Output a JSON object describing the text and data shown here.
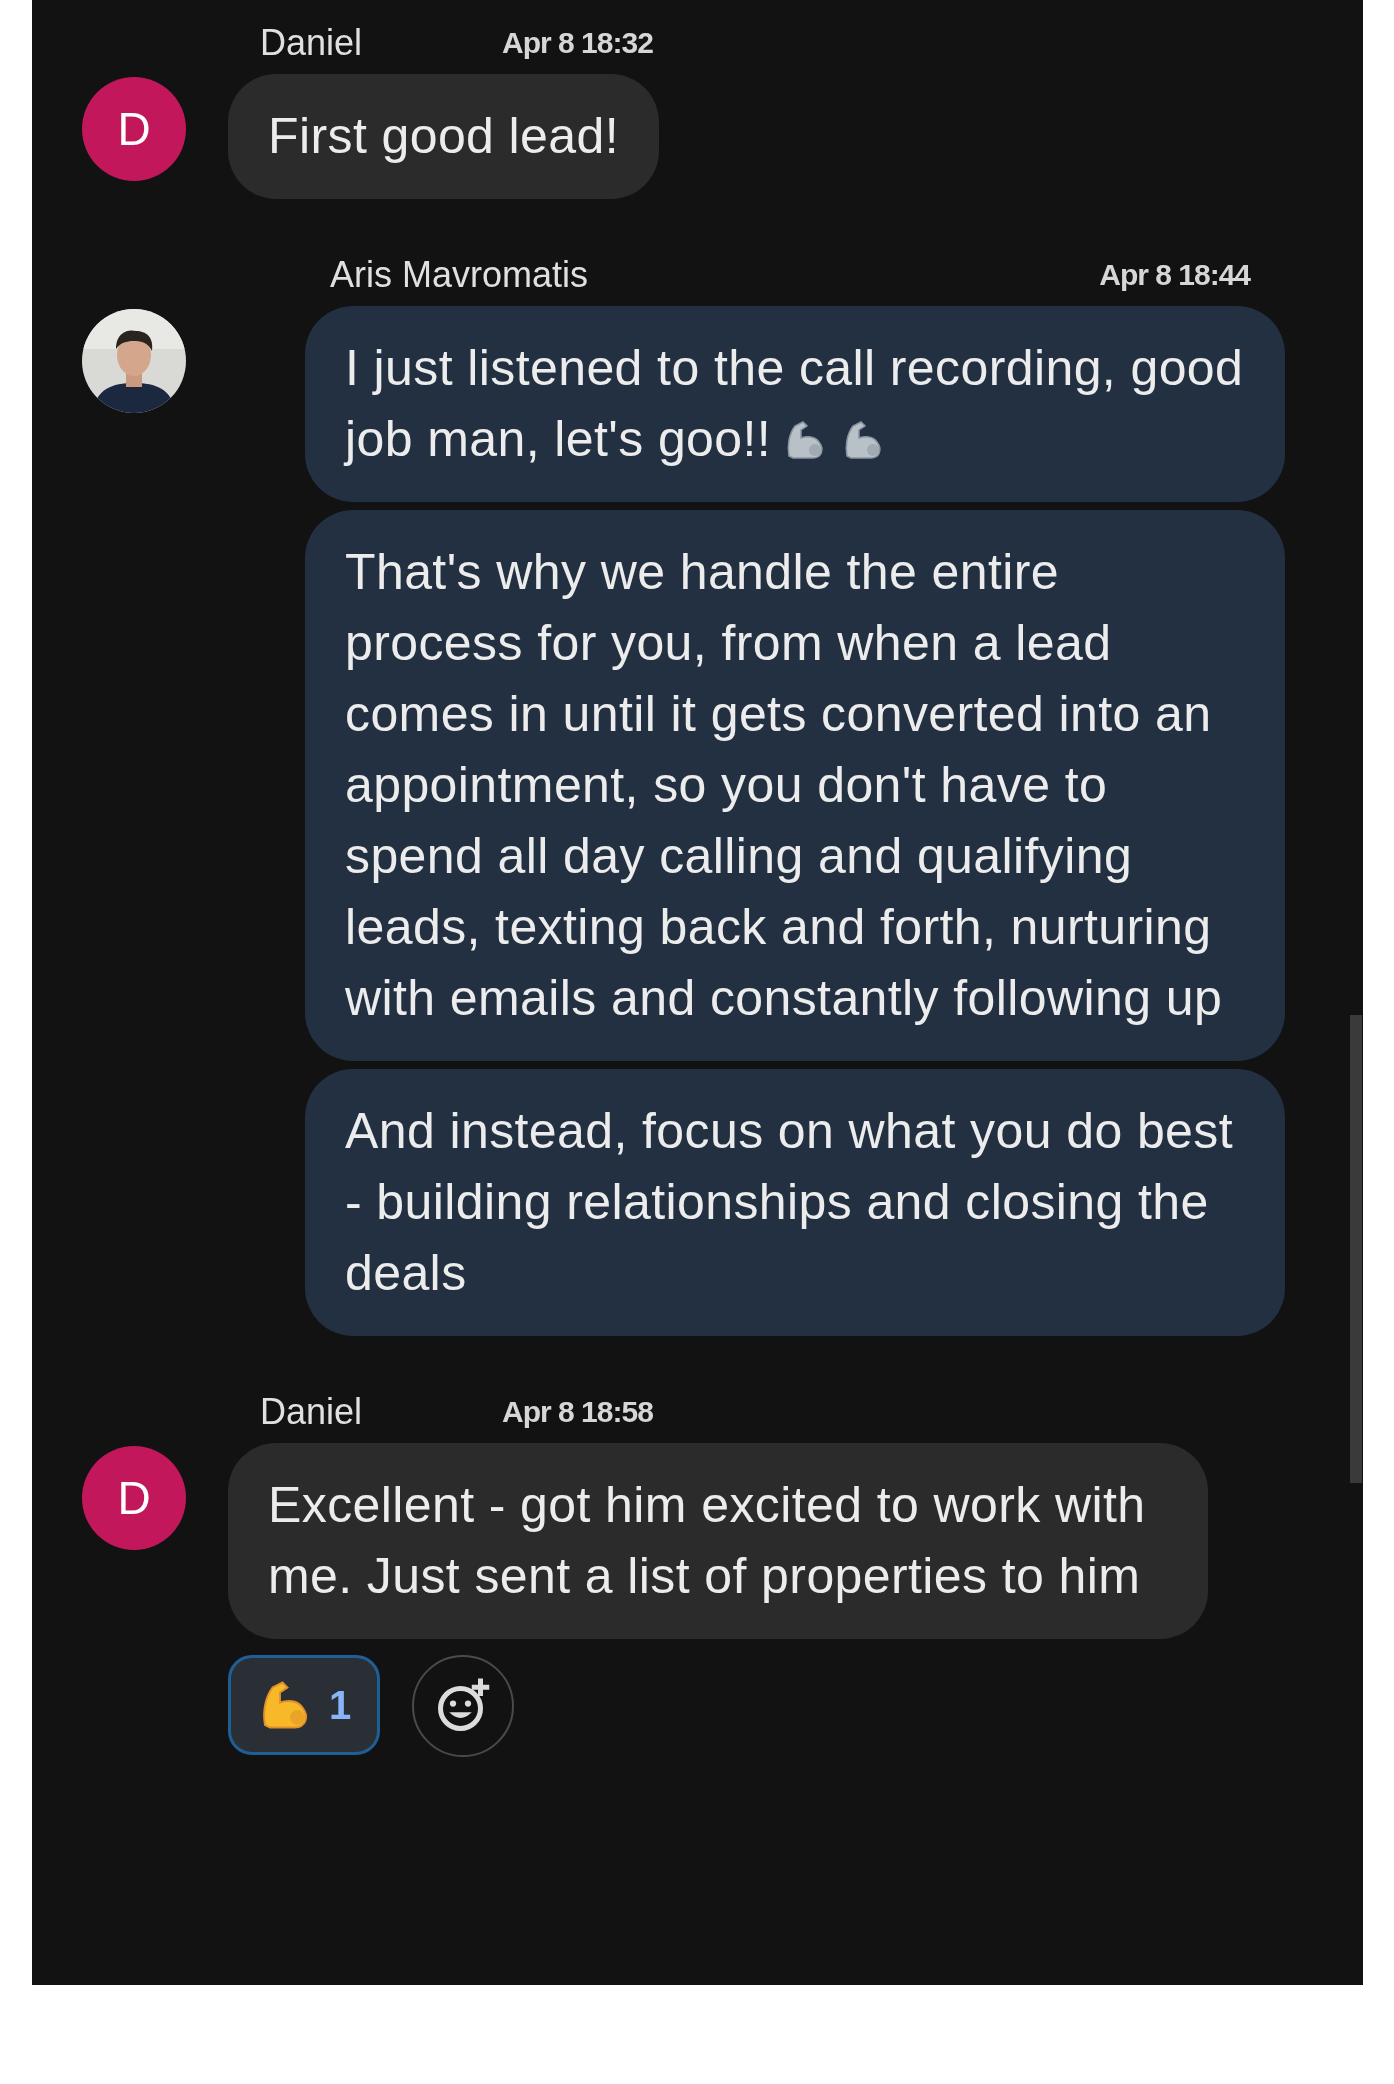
{
  "messages": [
    {
      "sender": "Daniel",
      "time": "Apr 8 18:32",
      "kind": "incoming",
      "avatar": {
        "kind": "initial",
        "letter": "D"
      },
      "bubbles": [
        {
          "kind": "text",
          "text": "First good lead!"
        }
      ]
    },
    {
      "sender": "Aris Mavromatis",
      "time": "Apr 8 18:44",
      "kind": "outgoing",
      "avatar": {
        "kind": "picture"
      },
      "bubbles": [
        {
          "kind": "text-emoji",
          "text": "I just listened to the call recording, good job man, let's goo!!"
        }
      ]
    },
    {
      "kind": "outgoing",
      "bubbles": [
        {
          "kind": "text",
          "text": "That's why we handle the entire process for you, from when a lead comes in until it gets converted into an appointment, so you don't have to spend all day calling and qualifying leads, texting back and forth, nurturing with emails and constantly following up"
        },
        {
          "kind": "text",
          "text": "And instead, focus on what you do best - building relationships and closing the deals"
        }
      ]
    },
    {
      "sender": "Daniel",
      "time": "Apr 8 18:58",
      "kind": "incoming",
      "avatar": {
        "kind": "initial",
        "letter": "D"
      },
      "bubbles": [
        {
          "kind": "text",
          "text": "Excellent - got him excited to work with me. Just sent a list of properties to him"
        }
      ],
      "reactions": [
        {
          "count": "1",
          "selected": true
        }
      ]
    }
  ]
}
